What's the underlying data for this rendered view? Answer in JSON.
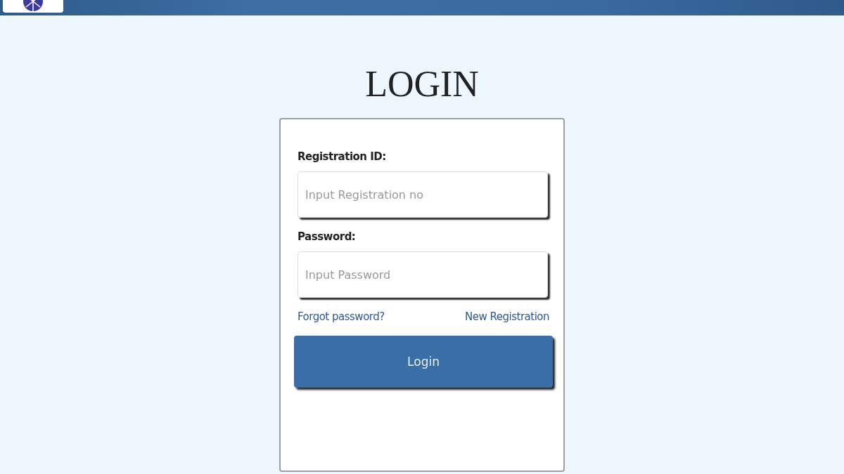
{
  "title": "LOGIN",
  "form": {
    "fields": [
      {
        "label": "Registration ID:",
        "placeholder": "Input Registration no"
      },
      {
        "label": "Password:",
        "placeholder": "Input Password"
      }
    ],
    "links": [
      "Forgot password?",
      "New Registration"
    ],
    "submit": "Login"
  }
}
